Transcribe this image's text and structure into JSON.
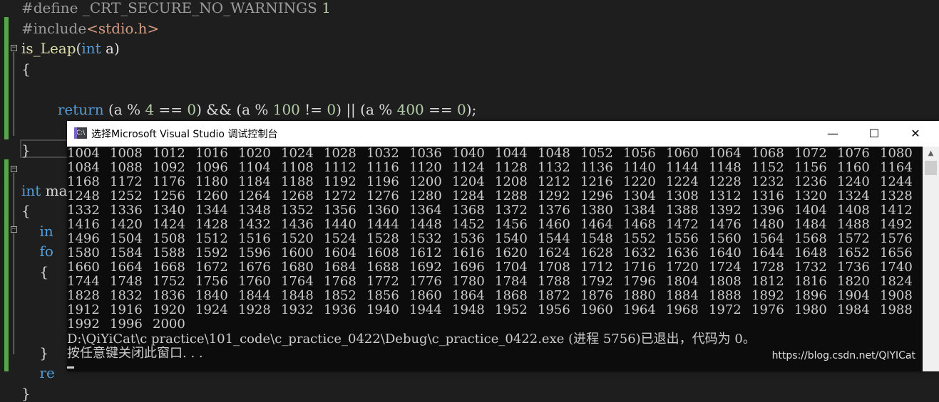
{
  "editor": {
    "lines": [
      {
        "id": "define",
        "parts": [
          [
            "pp",
            "#define "
          ],
          [
            "pp",
            "_CRT_SECURE_NO_WARNINGS"
          ],
          [
            "pp",
            " "
          ],
          [
            "num",
            "1"
          ]
        ]
      },
      {
        "id": "include",
        "parts": [
          [
            "pp",
            "#include"
          ],
          [
            "inc",
            "<stdio.h>"
          ]
        ]
      },
      {
        "id": "fn-sig",
        "parts": [
          [
            "fn",
            "is_Leap"
          ],
          [
            "",
            "("
          ],
          [
            "kw",
            "int"
          ],
          [
            "",
            " a)"
          ]
        ]
      },
      {
        "id": "open-brace",
        "parts": [
          [
            "",
            "{"
          ]
        ]
      },
      {
        "id": "blank1",
        "parts": [
          [
            "",
            ""
          ]
        ]
      },
      {
        "id": "return",
        "parts": [
          [
            "",
            "        "
          ],
          [
            "kw",
            "return"
          ],
          [
            "",
            " (a % "
          ],
          [
            "num",
            "4"
          ],
          [
            "",
            " == "
          ],
          [
            "num",
            "0"
          ],
          [
            "",
            ") && (a % "
          ],
          [
            "num",
            "100"
          ],
          [
            "",
            " != "
          ],
          [
            "num",
            "0"
          ],
          [
            "",
            ") || (a % "
          ],
          [
            "num",
            "400"
          ],
          [
            "",
            " == "
          ],
          [
            "num",
            "0"
          ],
          [
            "",
            ");"
          ]
        ]
      },
      {
        "id": "blank2",
        "parts": [
          [
            "",
            ""
          ]
        ]
      },
      {
        "id": "close-brace",
        "parts": [
          [
            "",
            "}"
          ]
        ]
      },
      {
        "id": "blank3",
        "parts": [
          [
            "",
            ""
          ]
        ]
      },
      {
        "id": "main-sig",
        "parts": [
          [
            "kw",
            "int"
          ],
          [
            "",
            " ma"
          ]
        ]
      },
      {
        "id": "main-open",
        "parts": [
          [
            "",
            "{"
          ]
        ]
      },
      {
        "id": "main-int",
        "parts": [
          [
            "",
            "    "
          ],
          [
            "kw",
            "in"
          ]
        ]
      },
      {
        "id": "main-for",
        "parts": [
          [
            "",
            "    "
          ],
          [
            "kw",
            "fo"
          ]
        ]
      },
      {
        "id": "for-open",
        "parts": [
          [
            "",
            "    {"
          ]
        ]
      },
      {
        "id": "blank4",
        "parts": [
          [
            "",
            ""
          ]
        ]
      },
      {
        "id": "blank5",
        "parts": [
          [
            "",
            ""
          ]
        ]
      },
      {
        "id": "blank6",
        "parts": [
          [
            "",
            ""
          ]
        ]
      },
      {
        "id": "for-close",
        "parts": [
          [
            "",
            "    }"
          ]
        ]
      },
      {
        "id": "main-ret",
        "parts": [
          [
            "",
            "    "
          ],
          [
            "kw",
            "re"
          ]
        ]
      },
      {
        "id": "main-close",
        "parts": [
          [
            "",
            "}"
          ]
        ]
      }
    ]
  },
  "console": {
    "title": "选择Microsoft Visual Studio 调试控制台",
    "icon_label": "C:\\",
    "minimize": "—",
    "maximize": "☐",
    "close": "✕",
    "rows": [
      [
        "1004",
        "1008",
        "1012",
        "1016",
        "1020",
        "1024",
        "1028",
        "1032",
        "1036",
        "1040",
        "1044",
        "1048",
        "1052",
        "1056",
        "1060",
        "1064",
        "1068",
        "1072",
        "1076",
        "1080"
      ],
      [
        "1084",
        "1088",
        "1092",
        "1096",
        "1104",
        "1108",
        "1112",
        "1116",
        "1120",
        "1124",
        "1128",
        "1132",
        "1136",
        "1140",
        "1144",
        "1148",
        "1152",
        "1156",
        "1160",
        "1164"
      ],
      [
        "1168",
        "1172",
        "1176",
        "1180",
        "1184",
        "1188",
        "1192",
        "1196",
        "1200",
        "1204",
        "1208",
        "1212",
        "1216",
        "1220",
        "1224",
        "1228",
        "1232",
        "1236",
        "1240",
        "1244"
      ],
      [
        "1248",
        "1252",
        "1256",
        "1260",
        "1264",
        "1268",
        "1272",
        "1276",
        "1280",
        "1284",
        "1288",
        "1292",
        "1296",
        "1304",
        "1308",
        "1312",
        "1316",
        "1320",
        "1324",
        "1328"
      ],
      [
        "1332",
        "1336",
        "1340",
        "1344",
        "1348",
        "1352",
        "1356",
        "1360",
        "1364",
        "1368",
        "1372",
        "1376",
        "1380",
        "1384",
        "1388",
        "1392",
        "1396",
        "1404",
        "1408",
        "1412"
      ],
      [
        "1416",
        "1420",
        "1424",
        "1428",
        "1432",
        "1436",
        "1440",
        "1444",
        "1448",
        "1452",
        "1456",
        "1460",
        "1464",
        "1468",
        "1472",
        "1476",
        "1480",
        "1484",
        "1488",
        "1492"
      ],
      [
        "1496",
        "1504",
        "1508",
        "1512",
        "1516",
        "1520",
        "1524",
        "1528",
        "1532",
        "1536",
        "1540",
        "1544",
        "1548",
        "1552",
        "1556",
        "1560",
        "1564",
        "1568",
        "1572",
        "1576"
      ],
      [
        "1580",
        "1584",
        "1588",
        "1592",
        "1596",
        "1600",
        "1604",
        "1608",
        "1612",
        "1616",
        "1620",
        "1624",
        "1628",
        "1632",
        "1636",
        "1640",
        "1644",
        "1648",
        "1652",
        "1656"
      ],
      [
        "1660",
        "1664",
        "1668",
        "1672",
        "1676",
        "1680",
        "1684",
        "1688",
        "1692",
        "1696",
        "1704",
        "1708",
        "1712",
        "1716",
        "1720",
        "1724",
        "1728",
        "1732",
        "1736",
        "1740"
      ],
      [
        "1744",
        "1748",
        "1752",
        "1756",
        "1760",
        "1764",
        "1768",
        "1772",
        "1776",
        "1780",
        "1784",
        "1788",
        "1792",
        "1796",
        "1804",
        "1808",
        "1812",
        "1816",
        "1820",
        "1824"
      ],
      [
        "1828",
        "1832",
        "1836",
        "1840",
        "1844",
        "1848",
        "1852",
        "1856",
        "1860",
        "1864",
        "1868",
        "1872",
        "1876",
        "1880",
        "1884",
        "1888",
        "1892",
        "1896",
        "1904",
        "1908"
      ],
      [
        "1912",
        "1916",
        "1920",
        "1924",
        "1928",
        "1932",
        "1936",
        "1940",
        "1944",
        "1948",
        "1952",
        "1956",
        "1960",
        "1964",
        "1968",
        "1972",
        "1976",
        "1980",
        "1984",
        "1988"
      ],
      [
        "1992",
        "1996",
        "2000"
      ]
    ],
    "exit_message": "D:\\QiYiCat\\c practice\\101_code\\c_practice_0422\\Debug\\c_practice_0422.exe (进程 5756)已退出，代码为 0。",
    "press_key": "按任意键关闭此窗口. . .",
    "watermark": "https://blog.csdn.net/QIYICat"
  },
  "colors": {
    "editor_bg": "#1e1e1e",
    "keyword": "#569cd6",
    "number": "#b5cea8",
    "console_bg": "#0c0c0c",
    "console_text": "#cccccc",
    "change_bar": "#57a64a"
  }
}
